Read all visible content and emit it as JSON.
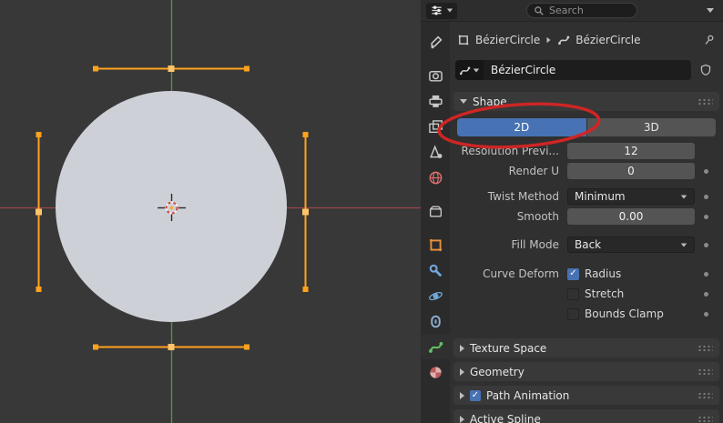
{
  "header": {
    "search_placeholder": "Search"
  },
  "breadcrumb": {
    "object_name": "BézierCircle",
    "data_name": "BézierCircle"
  },
  "name_field": {
    "value": "BézierCircle"
  },
  "tabs": [
    {
      "name": "active-tool"
    },
    {
      "name": "render-properties"
    },
    {
      "name": "output-properties"
    },
    {
      "name": "view-layer-properties"
    },
    {
      "name": "scene-properties"
    },
    {
      "name": "world-properties"
    },
    {
      "name": "collection-properties"
    },
    {
      "name": "object-properties"
    },
    {
      "name": "modifier-properties"
    },
    {
      "name": "physics-properties"
    },
    {
      "name": "constraint-properties"
    },
    {
      "name": "object-data-properties",
      "active": true
    },
    {
      "name": "material-properties"
    }
  ],
  "shape_panel": {
    "title": "Shape",
    "segmented": {
      "options": [
        "2D",
        "3D"
      ],
      "selected": "2D"
    },
    "rows": [
      {
        "label": "Resolution Previ...",
        "value": "12",
        "type": "number",
        "dot": false
      },
      {
        "label": "Render U",
        "value": "0",
        "type": "number",
        "dot": true
      },
      {
        "label": "Twist Method",
        "value": "Minimum",
        "type": "dropdown",
        "dot": true
      },
      {
        "label": "Smooth",
        "value": "0.00",
        "type": "number",
        "dot": true
      },
      {
        "label": "Fill Mode",
        "value": "Back",
        "type": "dropdown",
        "dot": true
      },
      {
        "label": "Curve Deform",
        "value": "Radius",
        "type": "checkbox",
        "checked": true,
        "dot": true
      },
      {
        "label": "",
        "value": "Stretch",
        "type": "checkbox",
        "checked": false,
        "dot": true
      },
      {
        "label": "",
        "value": "Bounds Clamp",
        "type": "checkbox",
        "checked": false,
        "dot": true
      }
    ]
  },
  "sections": [
    {
      "title": "Texture Space",
      "expanded": false
    },
    {
      "title": "Geometry",
      "expanded": false
    },
    {
      "title": "Path Animation",
      "expanded": false,
      "checkbox": true,
      "checked": true
    },
    {
      "title": "Active Spline",
      "expanded": false
    }
  ],
  "icons": {
    "search": "magnifier",
    "editor_type": "sliders",
    "pin": "pushpin",
    "fake_user": "shield",
    "grip": "drag-dots",
    "section_expanded": "chevron-down",
    "section_collapsed": "chevron-right",
    "dropdown": "chevron-down"
  },
  "colors": {
    "accent": "#4772b3",
    "selected_handle": "#ffa21e",
    "annotation": "#cf2525",
    "curve_fill": "#cdd0d6",
    "viewport_bg": "#383838"
  }
}
